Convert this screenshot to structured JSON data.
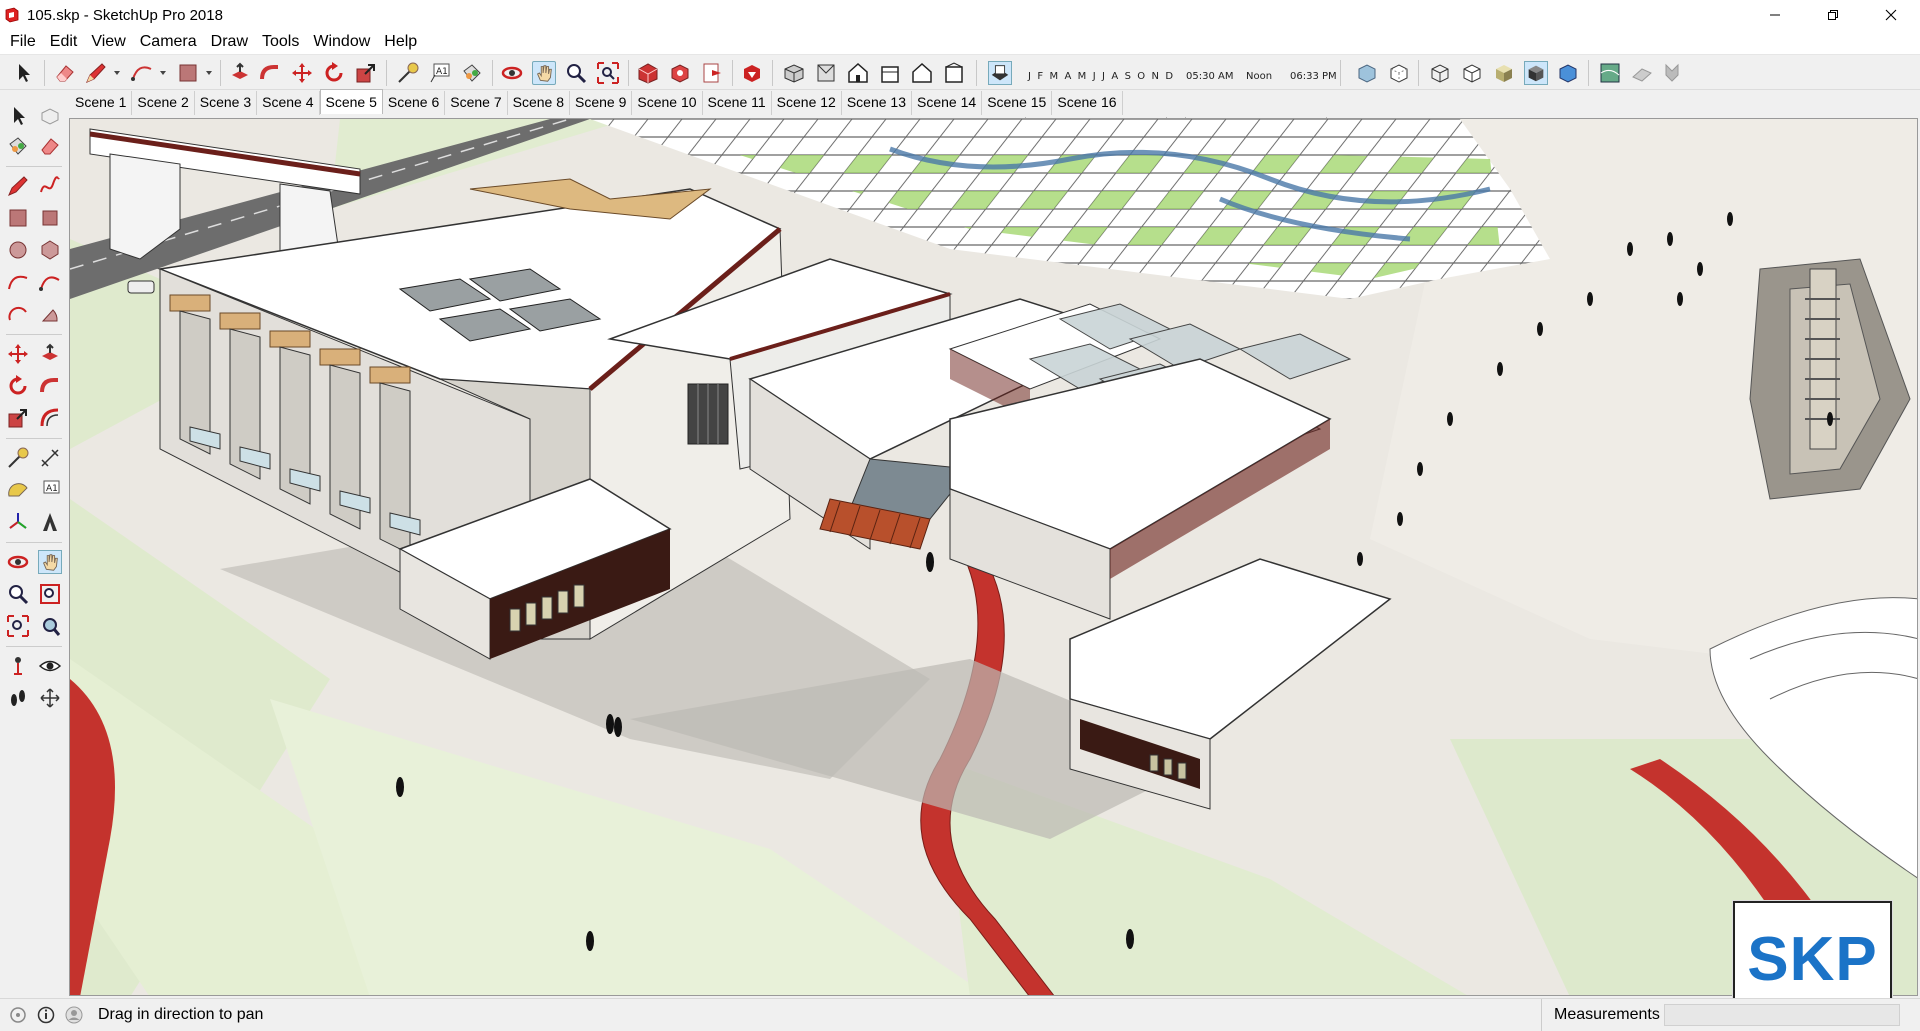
{
  "window": {
    "title": "105.skp - SketchUp Pro 2018",
    "controls": [
      "minimize-icon",
      "restore-icon",
      "close-icon"
    ]
  },
  "menubar": {
    "items": [
      "File",
      "Edit",
      "View",
      "Camera",
      "Draw",
      "Tools",
      "Window",
      "Help"
    ]
  },
  "shadows": {
    "months": "J F M A M J J A S O N D",
    "time_start": "05:30 AM",
    "time_mid": "Noon",
    "time_end": "06:33 PM"
  },
  "scenes": {
    "active": "Scene 5",
    "tabs": [
      "Scene 1",
      "Scene 2",
      "Scene 3",
      "Scene 4",
      "Scene 5",
      "Scene 6",
      "Scene 7",
      "Scene 8",
      "Scene 9",
      "Scene 10",
      "Scene 11",
      "Scene 12",
      "Scene 13",
      "Scene 14",
      "Scene 15",
      "Scene 16"
    ]
  },
  "status": {
    "hint": "Drag in direction to pan",
    "measurements_label": "Measurements",
    "measurements_value": ""
  },
  "badge": {
    "text": "SKP",
    "color": "#1b73c7"
  },
  "colors": {
    "accent_red": "#c4332d",
    "ground_green": "#dce8c8",
    "roof_white": "#ffffff",
    "trim_brown": "#6b1f1a"
  }
}
